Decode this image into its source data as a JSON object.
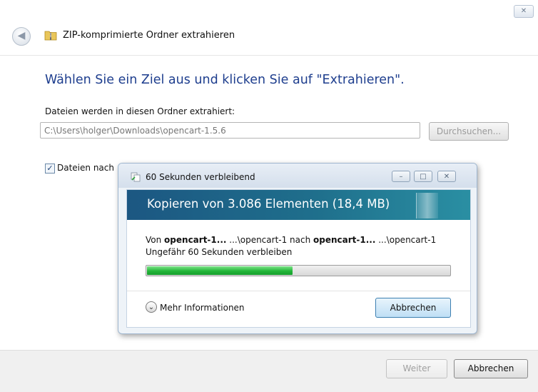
{
  "wizard": {
    "title": "ZIP-komprimierte Ordner extrahieren",
    "close_glyph": "✕",
    "back_glyph": "◀",
    "heading": "Wählen Sie ein Ziel aus und klicken Sie auf \"Extrahieren\".",
    "dest_label": "Dateien werden in diesen Ordner extrahiert:",
    "path_value": "C:\\Users\\holger\\Downloads\\opencart-1.5.6",
    "browse_label": "Durchsuchen...",
    "checkbox_label": "Dateien nach",
    "checkbox_checked": true,
    "next_label": "Weiter",
    "cancel_label": "Abbrechen"
  },
  "dialog": {
    "title": "60 Sekunden verbleibend",
    "banner": "Kopieren von 3.086 Elementen (18,4 MB)",
    "from_prefix": "Von ",
    "from_name": "opencart-1...",
    "from_path": " ...\\opencart-1 nach ",
    "to_name": "opencart-1...",
    "to_path": " ...\\opencart-1",
    "time_remaining": "Ungefähr 60 Sekunden verbleiben",
    "progress_fraction": 0.48,
    "more_info_label": "Mehr Informationen",
    "cancel_label": "Abbrechen"
  },
  "colors": {
    "heading": "#1e3e8e",
    "progress": "#22b638",
    "banner": "#1f6f8c"
  }
}
